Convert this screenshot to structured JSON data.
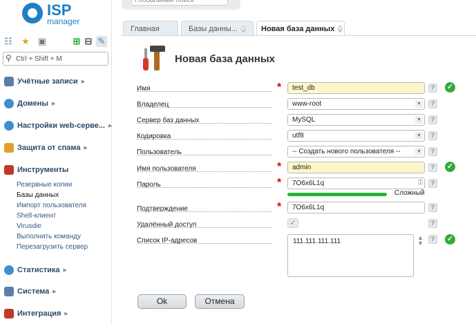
{
  "logo": {
    "brand": "ISP",
    "product": "manager"
  },
  "top_search": {
    "placeholder": "Глобальный поиск"
  },
  "sidebar": {
    "search_placeholder": "Ctrl + Shift + M",
    "sections": [
      {
        "label": "Учётные записи",
        "icon": "user-icon",
        "color": "#5b7fa6"
      },
      {
        "label": "Домены",
        "icon": "globe-icon",
        "color": "#3d8fd0"
      },
      {
        "label": "Настройки web-серве...",
        "icon": "web-settings-icon",
        "color": "#3d8fd0"
      },
      {
        "label": "Защита от спама",
        "icon": "spam-shield-icon",
        "color": "#e0a030"
      },
      {
        "label": "Инструменты",
        "icon": "tools-icon",
        "color": "#c0392b"
      },
      {
        "label": "Статистика",
        "icon": "stats-icon",
        "color": "#3d8fd0"
      },
      {
        "label": "Система",
        "icon": "system-icon",
        "color": "#5b7fa6"
      },
      {
        "label": "Интеграция",
        "icon": "integration-icon",
        "color": "#c0392b"
      }
    ],
    "tools_items": [
      "Резервные копии",
      "Базы данных",
      "Импорт пользователя",
      "Shell-клиент",
      "Virusdie",
      "Выполнить команду",
      "Перезагрузить сервер"
    ]
  },
  "tabs": [
    {
      "label": "Главная"
    },
    {
      "label": "Базы данны..."
    },
    {
      "label": "Новая база данных"
    }
  ],
  "form": {
    "title": "Новая база данных",
    "fields": {
      "name": {
        "label": "Имя",
        "value": "test_db"
      },
      "owner": {
        "label": "Владелец",
        "value": "www-root"
      },
      "server": {
        "label": "Сервер баз данных",
        "value": "MySQL"
      },
      "encoding": {
        "label": "Кодировка",
        "value": "utf8"
      },
      "user": {
        "label": "Пользователь",
        "value": "-- Создать нового пользователя --"
      },
      "username": {
        "label": "Имя пользователя",
        "value": "admin"
      },
      "password": {
        "label": "Пароль",
        "value": "7O6x6L1q",
        "strength": "Сложный"
      },
      "confirm": {
        "label": "Подтверждение",
        "value": "7O6x6L1q"
      },
      "remote": {
        "label": "Удалённый доступ",
        "checked": true
      },
      "ip_list": {
        "label": "Список IP-адресов",
        "value": "111.111.111.111"
      }
    },
    "help_glyph": "?",
    "required_glyph": "*",
    "ok_glyph": "✓",
    "buttons": {
      "ok": "Ok",
      "cancel": "Отмена"
    }
  },
  "colors": {
    "accent": "#1f7fc6",
    "ok_green": "#2fab3a",
    "required_red": "#dd0000",
    "yellow_field": "#fbf7c8"
  }
}
